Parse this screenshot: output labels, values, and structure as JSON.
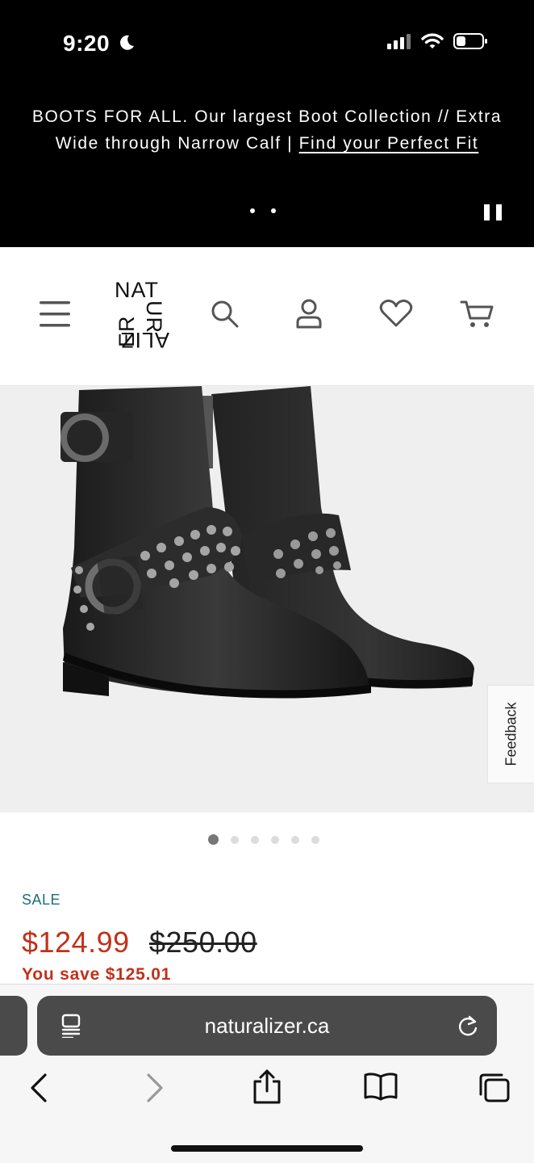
{
  "status_bar": {
    "time": "9:20"
  },
  "promo": {
    "text": "BOOTS FOR ALL. Our largest Boot Collection // Extra Wide through Narrow Calf |",
    "link": "Find your Perfect Fit"
  },
  "header": {
    "logo_letters": [
      "NAT",
      "UR",
      "ALIZ",
      "ER"
    ]
  },
  "feedback": {
    "label": "Feedback"
  },
  "carousel": {
    "count": 6,
    "active_index": 0
  },
  "pricing": {
    "sale_label": "SALE",
    "current_price": "$124.99",
    "original_price": "$250.00",
    "savings": "You save $125.01"
  },
  "browser": {
    "url": "naturalizer.ca"
  },
  "colors": {
    "sale_teal": "#1a6f7a",
    "price_red": "#c0311b",
    "url_bar": "#4a4a4a"
  }
}
